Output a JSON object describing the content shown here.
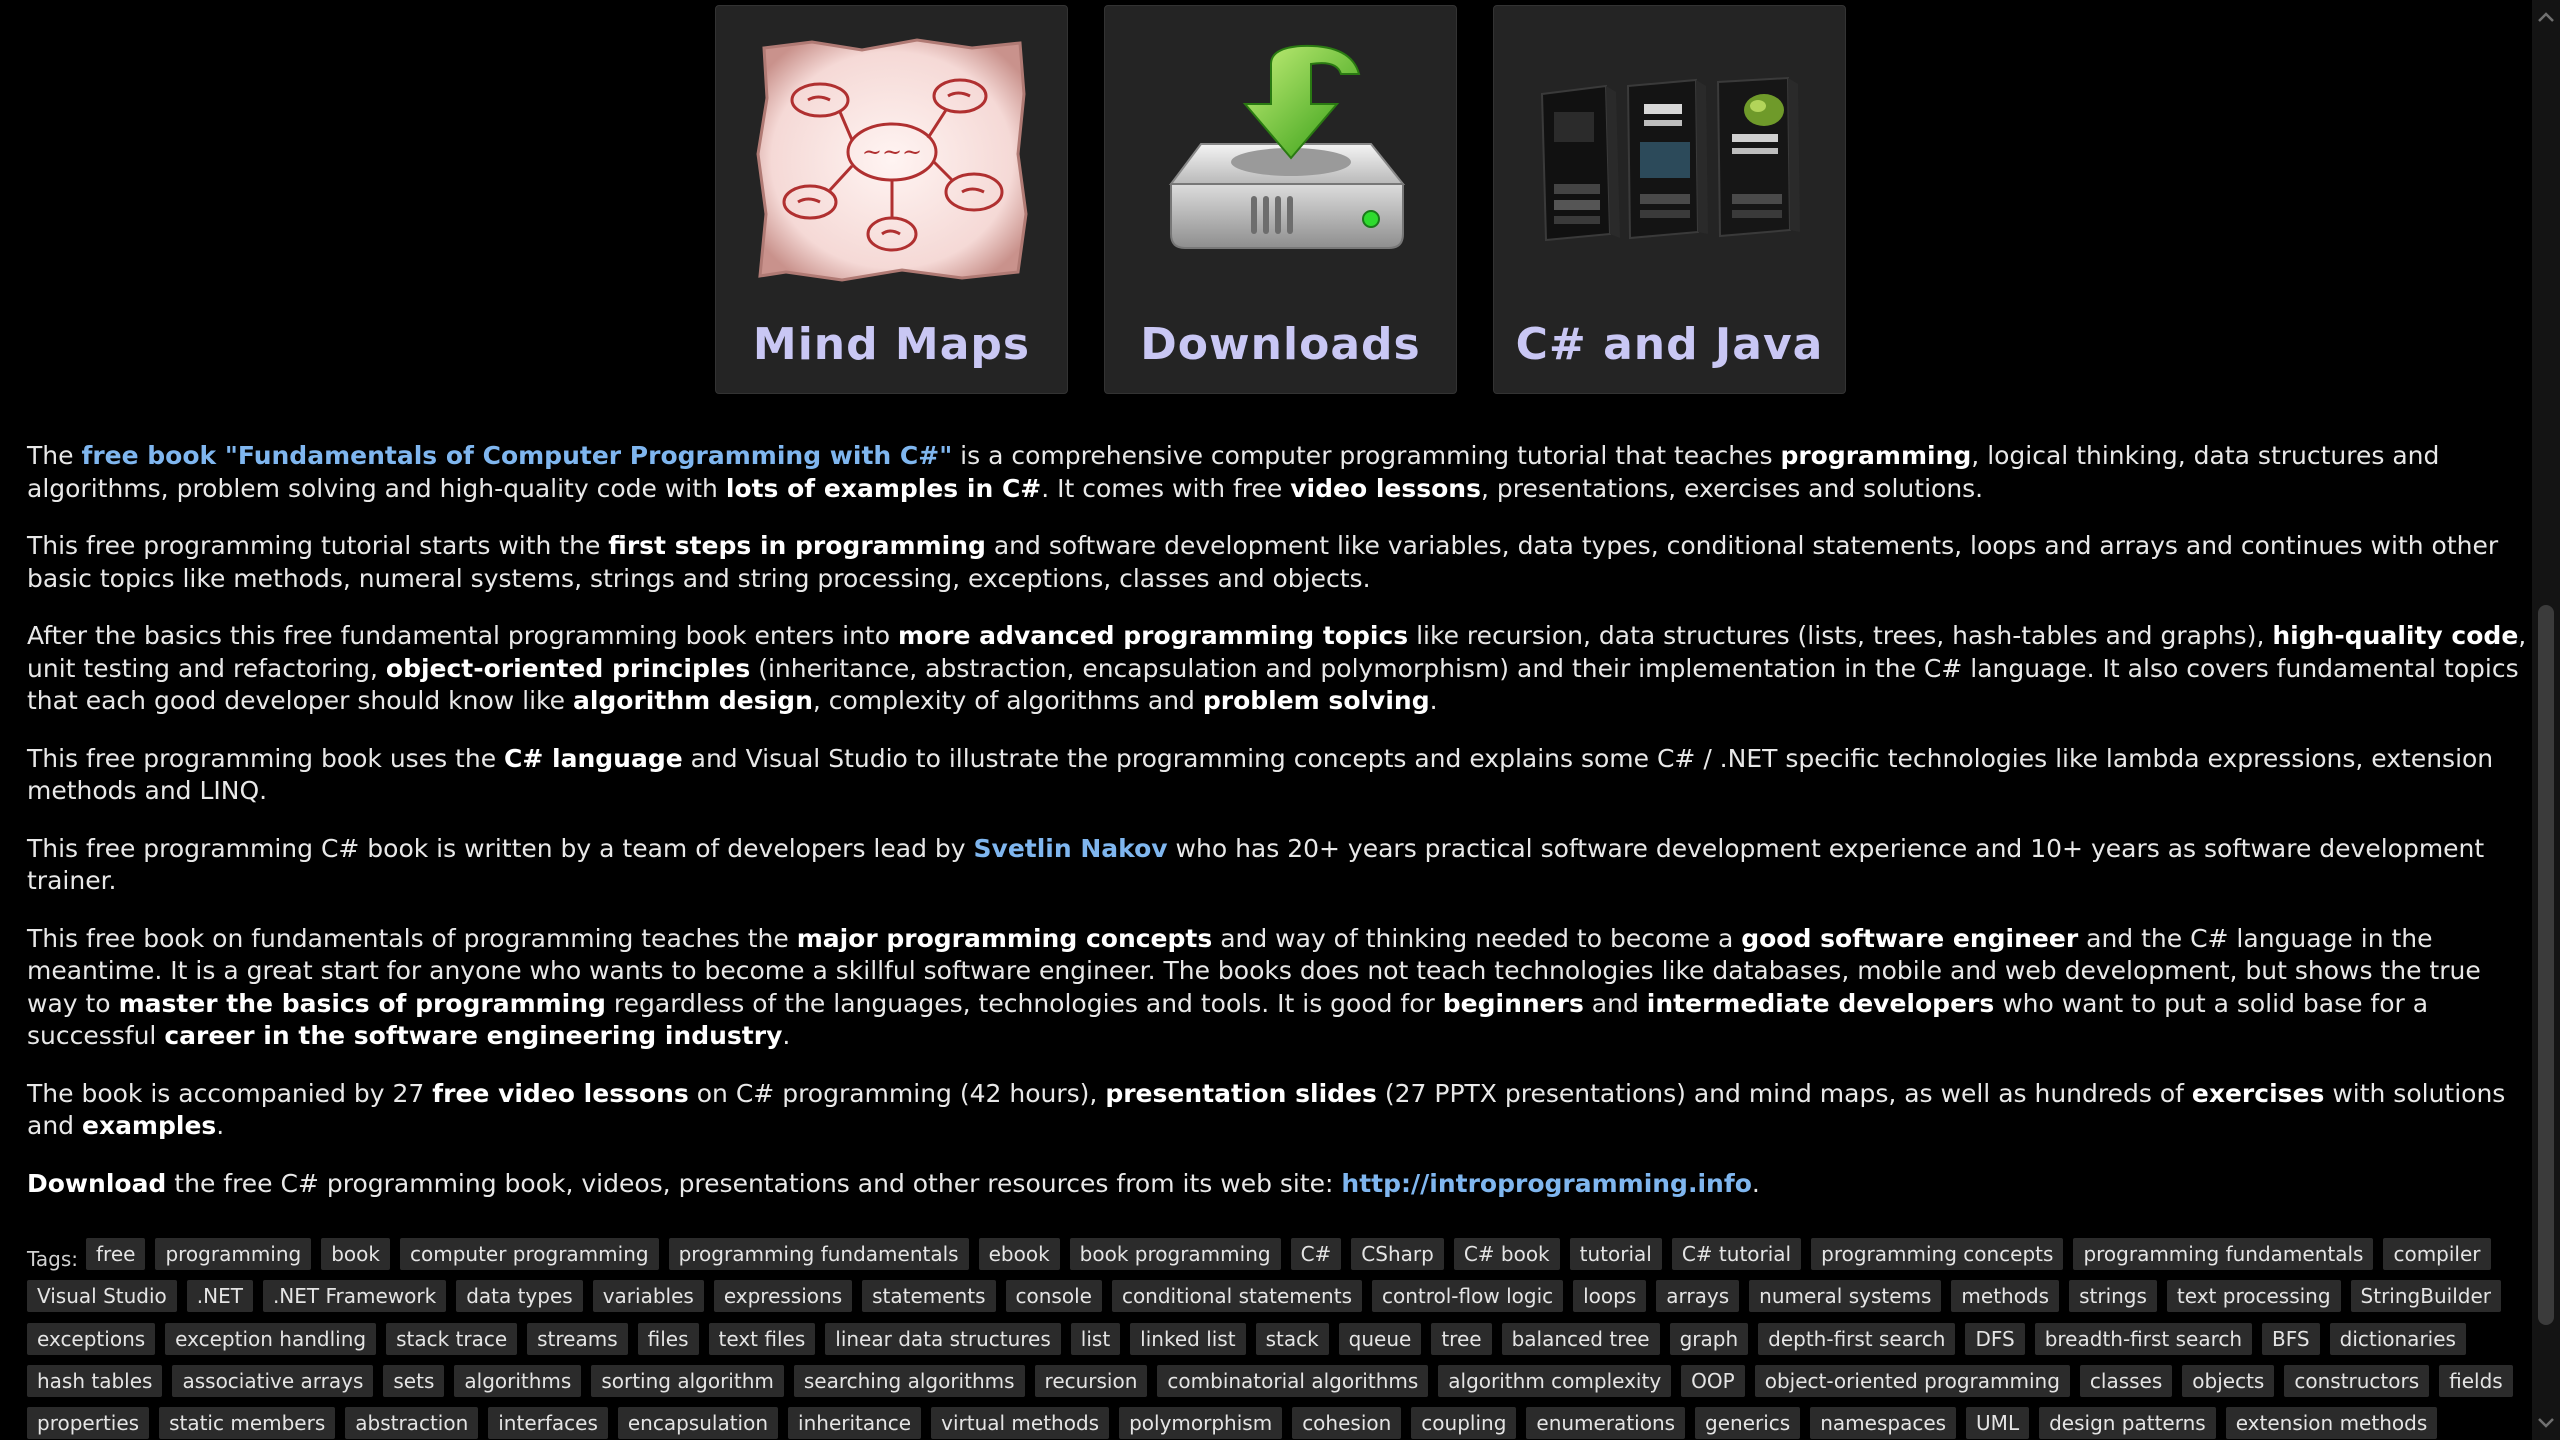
{
  "tiles": [
    {
      "label": "Mind Maps",
      "icon": "mind-map-image"
    },
    {
      "label": "Downloads",
      "icon": "download-drive-image"
    },
    {
      "label": "C# and Java",
      "icon": "book-covers-image"
    }
  ],
  "mindmap_center_text": "~~~",
  "paragraphs": {
    "p1": {
      "t1": "The ",
      "link": "free book \"Fundamentals of Computer Programming with C#\"",
      "t2": " is a comprehensive computer programming tutorial that teaches ",
      "b1": "programming",
      "t3": ", logical thinking, data structures and algorithms, problem solving and high-quality code with ",
      "b2": "lots of examples in C#",
      "t4": ". It comes with free ",
      "b3": "video lessons",
      "t5": ", presentations, exercises and solutions."
    },
    "p2": {
      "t1": "This free programming tutorial starts with the ",
      "b1": "first steps in programming",
      "t2": " and software development like variables, data types, conditional statements, loops and arrays and continues with other basic topics like methods, numeral systems, strings and string processing, exceptions, classes and objects."
    },
    "p3": {
      "t1": "After the basics this free fundamental programming book enters into ",
      "b1": "more advanced programming topics",
      "t2": " like recursion, data structures (lists, trees, hash-tables and graphs), ",
      "b2": "high-quality code",
      "t3": ", unit testing and refactoring, ",
      "b3": "object-oriented principles",
      "t4": " (inheritance, abstraction, encapsulation and polymorphism) and their implementation in the C# language. It also covers fundamental topics that each good developer should know like ",
      "b4": "algorithm design",
      "t5": ", complexity of algorithms and ",
      "b5": "problem solving",
      "t6": "."
    },
    "p4": {
      "t1": "This free programming book uses the ",
      "b1": "C# language",
      "t2": " and Visual Studio to illustrate the programming concepts and explains some C# / .NET specific technologies like lambda expressions, extension methods and LINQ."
    },
    "p5": {
      "t1": "This free programming C# book is written by a team of developers lead by ",
      "link": "Svetlin Nakov",
      "t2": " who has 20+ years practical software development experience and 10+ years as software development trainer."
    },
    "p6": {
      "t1": "This free book on fundamentals of programming teaches the ",
      "b1": "major programming concepts",
      "t2": " and way of thinking needed to become a ",
      "b2": "good software engineer",
      "t3": " and the C# language in the meantime. It is a great start for anyone who wants to become a skillful software engineer. The books does not teach technologies like databases, mobile and web development, but shows the true way to ",
      "b3": "master the basics of programming",
      "t4": " regardless of the languages, technologies and tools. It is good for ",
      "b4": "beginners",
      "t5": " and ",
      "b5": "intermediate developers",
      "t6": " who want to put a solid base for a successful ",
      "b6": "career in the software engineering industry",
      "t7": "."
    },
    "p7": {
      "t1": "The book is accompanied by 27 ",
      "b1": "free video lessons",
      "t2": " on C# programming (42 hours), ",
      "b2": "presentation slides",
      "t3": " (27 PPTX presentations) and mind maps, as well as hundreds of ",
      "b3": "exercises",
      "t4": " with solutions and ",
      "b4": "examples",
      "t5": "."
    },
    "p8": {
      "b1": "Download",
      "t1": " the free C# programming book, videos, presentations and other resources from its web site: ",
      "link": "http://introprogramming.info",
      "t2": "."
    }
  },
  "tags_label": "Tags:",
  "tags": [
    "free",
    "programming",
    "book",
    "computer programming",
    "programming fundamentals",
    "ebook",
    "book programming",
    "C#",
    "CSharp",
    "C# book",
    "tutorial",
    "C# tutorial",
    "programming concepts",
    "programming fundamentals",
    "compiler",
    "Visual Studio",
    ".NET",
    ".NET Framework",
    "data types",
    "variables",
    "expressions",
    "statements",
    "console",
    "conditional statements",
    "control-flow logic",
    "loops",
    "arrays",
    "numeral systems",
    "methods",
    "strings",
    "text processing",
    "StringBuilder",
    "exceptions",
    "exception handling",
    "stack trace",
    "streams",
    "files",
    "text files",
    "linear data structures",
    "list",
    "linked list",
    "stack",
    "queue",
    "tree",
    "balanced tree",
    "graph",
    "depth-first search",
    "DFS",
    "breadth-first search",
    "BFS",
    "dictionaries",
    "hash tables",
    "associative arrays",
    "sets",
    "algorithms",
    "sorting algorithm",
    "searching algorithms",
    "recursion",
    "combinatorial algorithms",
    "algorithm complexity",
    "OOP",
    "object-oriented programming",
    "classes",
    "objects",
    "constructors",
    "fields",
    "properties",
    "static members",
    "abstraction",
    "interfaces",
    "encapsulation",
    "inheritance",
    "virtual methods",
    "polymorphism",
    "cohesion",
    "coupling",
    "enumerations",
    "generics",
    "namespaces",
    "UML",
    "design patterns",
    "extension methods"
  ],
  "colors": {
    "background": "#000000",
    "text": "#e8e8e8",
    "link": "#7fb6ef",
    "tile_label": "#c9c7f4",
    "tile_bg": "#242424",
    "tag_bg": "#2b2b2b"
  },
  "scrollbar": {
    "up_icon": "chevron-up-icon",
    "down_icon": "chevron-down-icon"
  }
}
